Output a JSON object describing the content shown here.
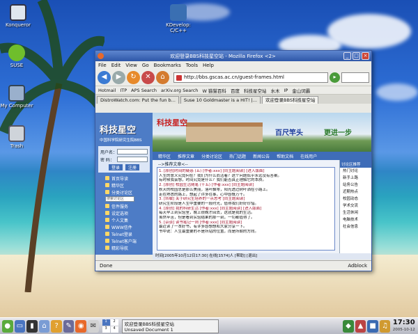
{
  "desktop": {
    "icons": [
      {
        "label": "Konqueror"
      },
      {
        "label": "KDevelop: C/C++"
      },
      {
        "label": "SUSE"
      },
      {
        "label": "My Computer"
      },
      {
        "label": "Trash"
      }
    ]
  },
  "window": {
    "title": "欢迎登录BBS科技星空站 - Mozilla Firefox <2>",
    "menu": [
      "File",
      "Edit",
      "View",
      "Go",
      "Bookmarks",
      "Tools",
      "Help"
    ],
    "url": "http://bbs.gscas.ac.cn/guest-frames.html",
    "bookmarks": [
      "Hotmail",
      "ITP",
      "APS Search",
      "arXiv.org Search",
      "W 猫猫百科",
      "百度",
      "科技星空站",
      "水木",
      "IP",
      "金山词霸"
    ],
    "tabs": [
      {
        "label": "DistroWatch.com: Put the fun b..."
      },
      {
        "label": "Suse 10 Goldmaster is a HIT! |..."
      },
      {
        "label": "欢迎登录BBS科技星空站"
      }
    ],
    "status_left": "Done",
    "status_right": "Adblock"
  },
  "bbs": {
    "logo": "科技星空",
    "subtitle": "中国科学院研究生院BBS",
    "user_label": "用户名：",
    "pass_label": "密  码：",
    "login_btn": "登录",
    "register_btn": "注册",
    "banner_text1": "科技星空",
    "banner_text2": "百尺竿头",
    "banner_text3": "更进一步",
    "nav": [
      "精华区",
      "推荐文章",
      "分类讨论区",
      "热门话题",
      "新闻公告",
      "帮助文档",
      "在线用户"
    ],
    "left_menu": [
      "首页导读",
      "精华区",
      "分类讨论区",
      "我的收藏",
      "讨论区搜索",
      "信件服务",
      "设定选项",
      "个人文集",
      "WWW信件",
      "Telnet登录",
      "Telnet客户端",
      "精彩导航"
    ],
    "search_placeholder": "搜索讨论区",
    "posts_header": "-->推荐文章<--",
    "posts": [
      "1. [原创]时间的疑惑 (五)  [作者:xxx]  [同主题阅读] [进入版面]",
      "   人生的意义究竟何在？我们为什么而活着？这个问题似乎永远没有答案。",
      "   有时候我会想，时间究竟是什么？我们能否真正理解它的本质。",
      "2. [原创] 校园生活随笔 (十五)  [作者:xxx]  [同主题阅读]",
      "   秋天的校园总是那么美丽，落叶飘零，阳光透过树叶洒在小路上。",
      "   走在熟悉的路上，想起了许多往事，心中感慨万千。",
      "3. [转载] 关于研究生培养的一点思考  [同主题阅读]",
      "   研究生阶段是人生中重要的一段时光，值得我们好好珍惜。",
      "4. [原创] 我的科研生活  [作者:xxx]  [同主题阅读] [进入版面]",
      "   每天早上到实验室，晚上很晚才回去，这就是我的生活。",
      "   虽然辛苦，但是看到实验结果的那一刻，一切都值得了。",
      "5. [杂谈] 读书笔记一则  [作者:xxx]  [同主题阅读]",
      "   最近读了一本好书，有许多感想想和大家分享一下。",
      "   书中说：人生最重要的不是所站的位置，而是所朝的方向。"
    ],
    "footer_line": "时间[2005年10月12日17:30]  在线[1574]人  [帮助]  [退出]",
    "side_links": [
      "讨论区推荐",
      "热门讨论",
      "新手上路",
      "站务公告",
      "近期热点",
      "校园动态",
      "学术交流",
      "生活休闲",
      "电脑技术",
      "社会信息"
    ]
  },
  "panel": {
    "task1_title": "欢迎登录BBS科技星空站",
    "task2_title": "Unsaved Document 1",
    "desk1": "1",
    "desk2": "2",
    "desk3": "3",
    "desk4": "4",
    "time": "17:30",
    "date": "2005-10-12"
  },
  "colors": {
    "bbs_blue": "#4d7cc6",
    "title_red": "#a0102a",
    "firefox_orange": "#e8692a"
  }
}
